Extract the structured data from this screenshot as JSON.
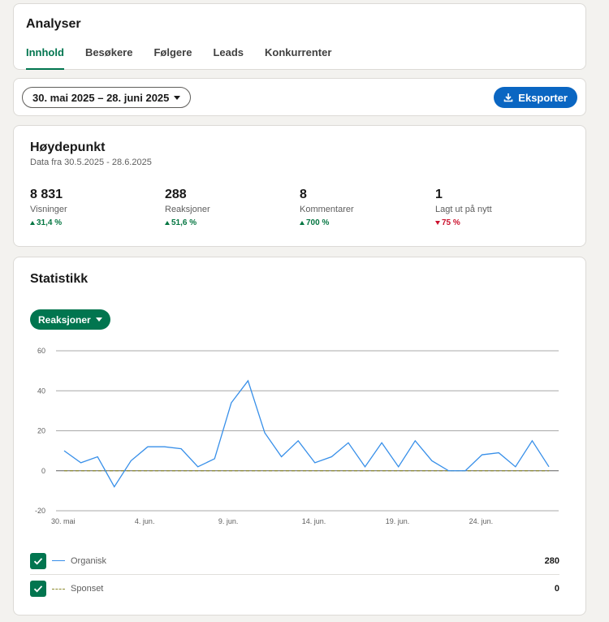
{
  "header": {
    "title": "Analyser",
    "tabs": [
      {
        "label": "Innhold",
        "active": true
      },
      {
        "label": "Besøkere",
        "active": false
      },
      {
        "label": "Følgere",
        "active": false
      },
      {
        "label": "Leads",
        "active": false
      },
      {
        "label": "Konkurrenter",
        "active": false
      }
    ]
  },
  "toolbar": {
    "date_range": "30. mai 2025 – 28. juni 2025",
    "export_label": "Eksporter"
  },
  "highlights": {
    "title": "Høydepunkt",
    "subtitle": "Data fra 30.5.2025 - 28.6.2025",
    "metrics": [
      {
        "value": "8 831",
        "label": "Visninger",
        "change": "31,4 %",
        "direction": "up"
      },
      {
        "value": "288",
        "label": "Reaksjoner",
        "change": "51,6 %",
        "direction": "up"
      },
      {
        "value": "8",
        "label": "Kommentarer",
        "change": "700 %",
        "direction": "up"
      },
      {
        "value": "1",
        "label": "Lagt ut på nytt",
        "change": "75 %",
        "direction": "down"
      }
    ]
  },
  "stats": {
    "title": "Statistikk",
    "metric_selector": "Reaksjoner",
    "legend": [
      {
        "name": "Organisk",
        "total": "280",
        "color": "#378fe9",
        "style": "solid"
      },
      {
        "name": "Sponset",
        "total": "0",
        "color": "#8c8a2e",
        "style": "dashed"
      }
    ]
  },
  "colors": {
    "accent_green": "#01754f",
    "export_blue": "#0a66c2",
    "organic_line": "#378fe9",
    "sponsored_line": "#8c8a2e"
  },
  "chart_data": {
    "type": "line",
    "x": [
      "30. mai",
      "31. mai",
      "1. jun.",
      "2. jun.",
      "3. jun.",
      "4. jun.",
      "5. jun.",
      "6. jun.",
      "7. jun.",
      "8. jun.",
      "9. jun.",
      "10. jun.",
      "11. jun.",
      "12. jun.",
      "13. jun.",
      "14. jun.",
      "15. jun.",
      "16. jun.",
      "17. jun.",
      "18. jun.",
      "19. jun.",
      "20. jun.",
      "21. jun.",
      "22. jun.",
      "23. jun.",
      "24. jun.",
      "25. jun.",
      "26. jun.",
      "27. jun.",
      "28. jun."
    ],
    "x_tick_labels": [
      "30. mai",
      "4. jun.",
      "9. jun.",
      "14. jun.",
      "19. jun.",
      "24. jun."
    ],
    "x_tick_index": [
      0,
      5,
      10,
      15,
      20,
      25
    ],
    "series": [
      {
        "name": "Organisk",
        "values": [
          10,
          4,
          7,
          -8,
          5,
          12,
          12,
          11,
          2,
          6,
          34,
          45,
          19,
          7,
          15,
          4,
          7,
          14,
          2,
          14,
          2,
          15,
          5,
          0,
          0,
          8,
          9,
          2,
          15,
          2
        ]
      },
      {
        "name": "Sponset",
        "values": [
          0,
          0,
          0,
          0,
          0,
          0,
          0,
          0,
          0,
          0,
          0,
          0,
          0,
          0,
          0,
          0,
          0,
          0,
          0,
          0,
          0,
          0,
          0,
          0,
          0,
          0,
          0,
          0,
          0,
          0
        ]
      }
    ],
    "yticks": [
      60,
      40,
      20,
      0,
      -20
    ],
    "ylim": [
      -20,
      60
    ],
    "grid": true,
    "title": "",
    "xlabel": "",
    "ylabel": ""
  }
}
